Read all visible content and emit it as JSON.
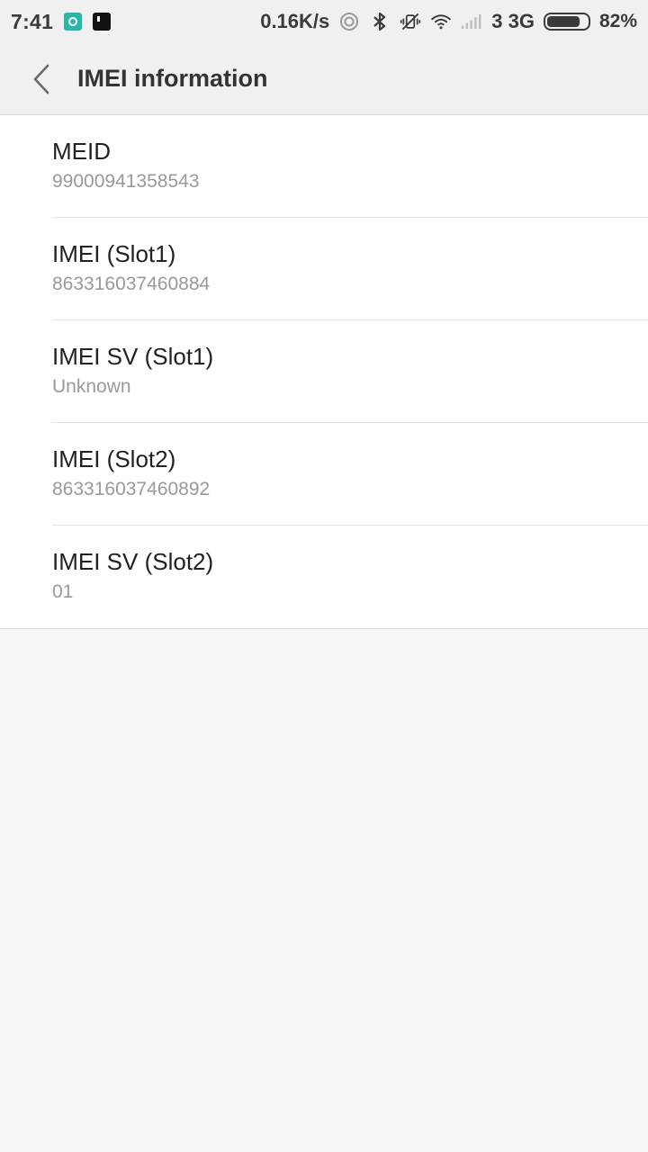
{
  "status_bar": {
    "time": "7:41",
    "net_speed": "0.16K/s",
    "network": "3 3G",
    "battery_level": 0.82,
    "battery_text": "82%",
    "icons": [
      "app-notification-icon",
      "app-notification-icon",
      "hotspot-icon",
      "bluetooth-icon",
      "vibrate-off-icon",
      "wifi-icon",
      "signal-icon",
      "battery-icon"
    ]
  },
  "header": {
    "title": "IMEI information",
    "back_icon": "back-arrow-icon"
  },
  "items": [
    {
      "label": "MEID",
      "value": "99000941358543"
    },
    {
      "label": "IMEI (Slot1)",
      "value": "863316037460884"
    },
    {
      "label": "IMEI SV (Slot1)",
      "value": "Unknown"
    },
    {
      "label": "IMEI (Slot2)",
      "value": "863316037460892"
    },
    {
      "label": "IMEI SV (Slot2)",
      "value": "01"
    }
  ],
  "colors": {
    "background": "#f6f6f6",
    "header_bg": "#f0f0f0",
    "list_bg": "#ffffff",
    "secondary_text": "#999999"
  }
}
